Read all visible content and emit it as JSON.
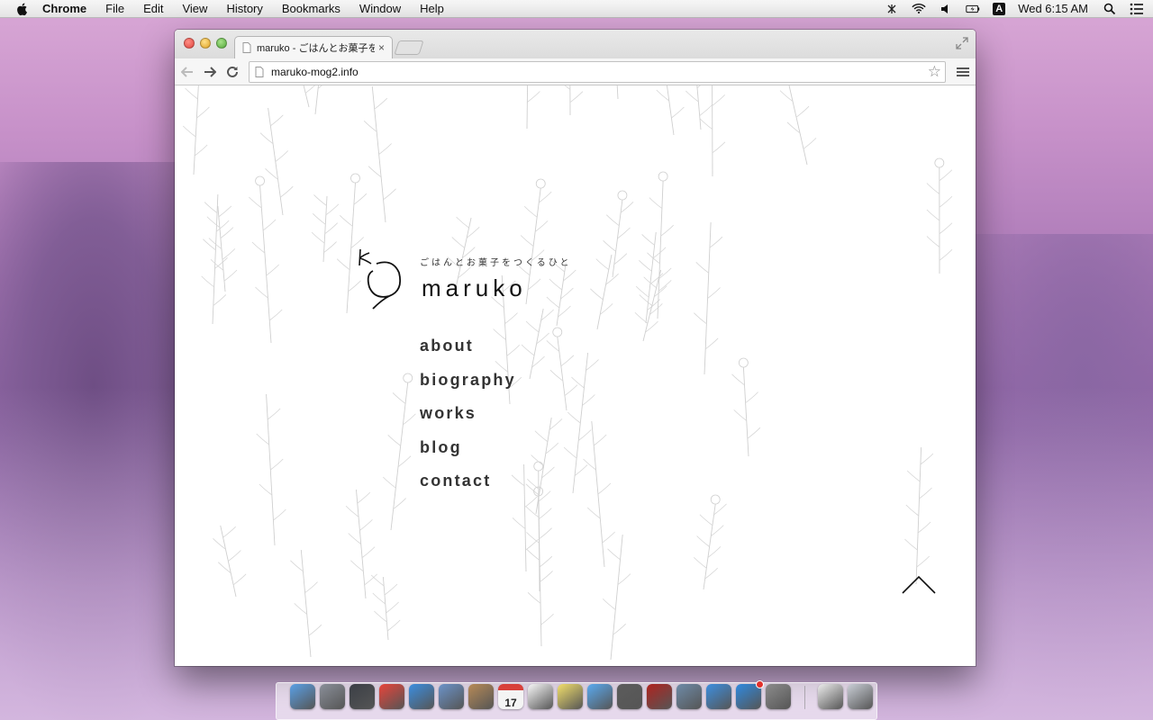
{
  "menubar": {
    "app": "Chrome",
    "items": [
      "File",
      "Edit",
      "View",
      "History",
      "Bookmarks",
      "Window",
      "Help"
    ],
    "clock": "Wed 6:15 AM",
    "input_source": "A"
  },
  "browser": {
    "tab_title": "maruko - ごはんとお菓子を",
    "tab_close": "×",
    "url": "maruko-mog2.info"
  },
  "site": {
    "tagline": "ごはんとお菓子をつくるひと",
    "brand": "maruko",
    "nav": [
      "about",
      "biography",
      "works",
      "blog",
      "contact"
    ]
  },
  "dock": {
    "apps": [
      {
        "name": "finder-icon",
        "color": "#5aa0e6"
      },
      {
        "name": "launchpad-icon",
        "color": "#8a8f99"
      },
      {
        "name": "mission-control-icon",
        "color": "#3b3f46"
      },
      {
        "name": "chrome-icon",
        "color": "#e8443a"
      },
      {
        "name": "safari-icon",
        "color": "#3b8ee0"
      },
      {
        "name": "mail-icon",
        "color": "#6b93c9"
      },
      {
        "name": "contacts-icon",
        "color": "#b78a56"
      },
      {
        "name": "calendar-icon",
        "color": "#f4f4f4"
      },
      {
        "name": "reminders-icon",
        "color": "#f7f7f7"
      },
      {
        "name": "notes-icon",
        "color": "#f2df6b"
      },
      {
        "name": "messages-icon",
        "color": "#5aaaf0"
      },
      {
        "name": "facetime-icon",
        "color": "#5c5c5c"
      },
      {
        "name": "photo-booth-icon",
        "color": "#b0231f"
      },
      {
        "name": "iphoto-icon",
        "color": "#6e8ba8"
      },
      {
        "name": "itunes-icon",
        "color": "#3d8fe0"
      },
      {
        "name": "app-store-icon",
        "color": "#2f8ae0"
      },
      {
        "name": "system-preferences-icon",
        "color": "#8c8c8c"
      },
      {
        "name": "document-icon",
        "color": "#ececec"
      },
      {
        "name": "trash-icon",
        "color": "#c9ced6"
      }
    ],
    "calendar_day": "17"
  }
}
